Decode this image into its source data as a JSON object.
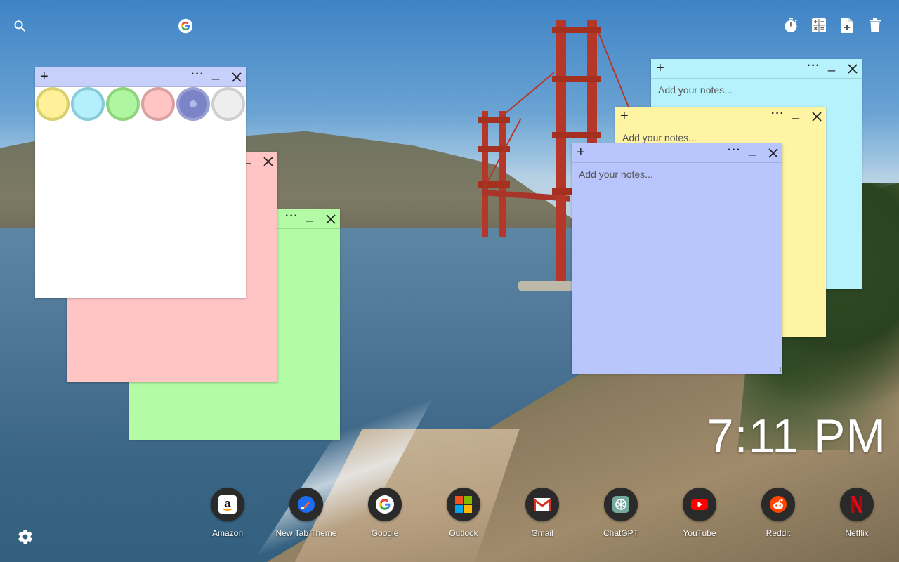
{
  "search": {
    "placeholder": ""
  },
  "top_tools": [
    {
      "name": "timer-icon"
    },
    {
      "name": "calculator-icon"
    },
    {
      "name": "add-note-icon"
    },
    {
      "name": "trash-icon"
    }
  ],
  "notes": {
    "white": {
      "color": "#ffffff",
      "placeholder": ""
    },
    "pink": {
      "color": "#ffc4c4",
      "placeholder": ""
    },
    "green": {
      "color": "#b3fba5",
      "placeholder": ""
    },
    "cyan": {
      "color": "#b5f2fc",
      "placeholder": "Add your notes..."
    },
    "yellow": {
      "color": "#fff4a3",
      "placeholder": "Add your notes..."
    },
    "blue": {
      "color": "#b9c6fd",
      "placeholder": "Add your notes..."
    }
  },
  "swatches": [
    {
      "name": "yellow",
      "fill": "#fff09a",
      "ring": "#d8cf6d"
    },
    {
      "name": "cyan",
      "fill": "#b3f0fb",
      "ring": "#86cdd8"
    },
    {
      "name": "green",
      "fill": "#b0f59f",
      "ring": "#8fd47d"
    },
    {
      "name": "pink",
      "fill": "#ffc4c4",
      "ring": "#dba0a0"
    },
    {
      "name": "blue",
      "fill": "#7b84c6",
      "ring": "#9aa1d4"
    },
    {
      "name": "gray",
      "fill": "#eeeeee",
      "ring": "#cfcfcf"
    }
  ],
  "clock": {
    "time": "7:11 PM"
  },
  "shortcuts": [
    {
      "label": "Amazon",
      "icon": "amazon-icon"
    },
    {
      "label": "New Tab Theme",
      "icon": "new-tab-theme-icon"
    },
    {
      "label": "Google",
      "icon": "google-icon"
    },
    {
      "label": "Outlook",
      "icon": "outlook-icon"
    },
    {
      "label": "Gmail",
      "icon": "gmail-icon"
    },
    {
      "label": "ChatGPT",
      "icon": "chatgpt-icon"
    },
    {
      "label": "YouTube",
      "icon": "youtube-icon"
    },
    {
      "label": "Reddit",
      "icon": "reddit-icon"
    },
    {
      "label": "Netflix",
      "icon": "netflix-icon"
    }
  ]
}
